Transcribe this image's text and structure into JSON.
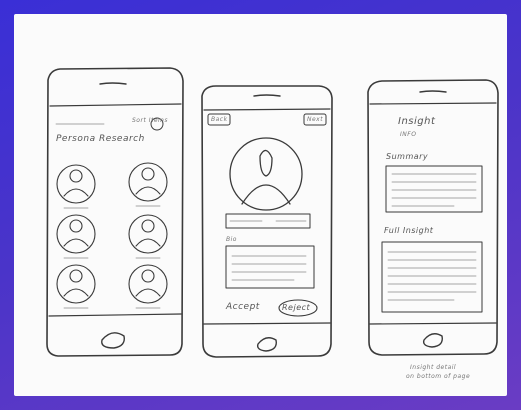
{
  "screens": {
    "phone1": {
      "top_right_text": "Sort Items",
      "heading": "Persona Research",
      "avatars": [
        "avatar",
        "avatar",
        "avatar",
        "avatar",
        "avatar",
        "avatar"
      ]
    },
    "phone2": {
      "back_label": "Back",
      "next_label": "Next",
      "bio_label": "Bio",
      "accept_label": "Accept",
      "reject_label": "Reject"
    },
    "phone3": {
      "title": "Insight",
      "subtitle": "INFO",
      "section1": "Summary",
      "section2": "Full Insight",
      "caption_line1": "Insight detail",
      "caption_line2": "on bottom of page"
    }
  },
  "colors": {
    "background_start": "#3a2fd6",
    "background_end": "#6a3cc4",
    "paper": "#fbfbfb",
    "pencil": "#3a3a3a"
  }
}
